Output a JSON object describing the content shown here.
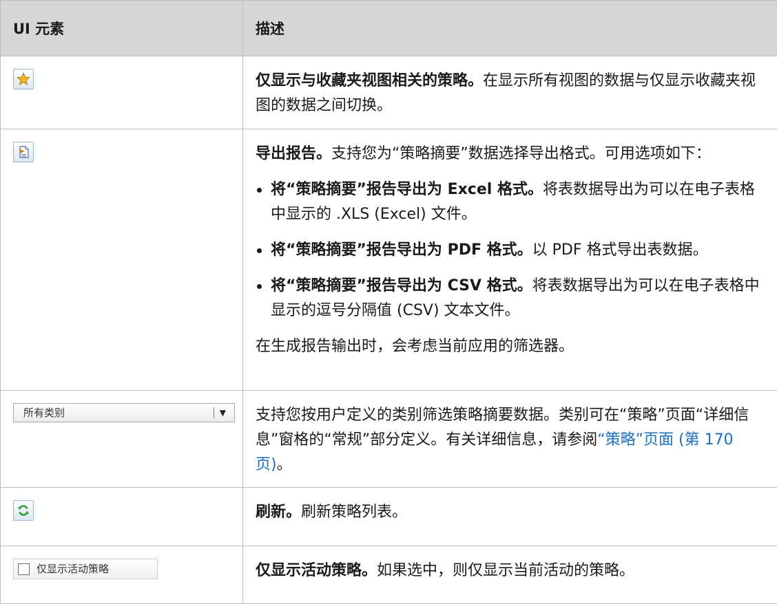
{
  "header": {
    "col1": "UI 元素",
    "col2": "描述"
  },
  "rows": {
    "favorites": {
      "icon": "star-icon",
      "title": "仅显示与收藏夹视图相关的策略。",
      "text": "在显示所有视图的数据与仅显示收藏夹视图的数据之间切换。"
    },
    "export": {
      "icon": "export-report-icon",
      "title": "导出报告。",
      "text": "支持您为“策略摘要”数据选择导出格式。可用选项如下：",
      "options": [
        {
          "bold": "将“策略摘要”报告导出为 Excel 格式。",
          "text": "将表数据导出为可以在电子表格中显示的 .XLS (Excel) 文件。"
        },
        {
          "bold": "将“策略摘要”报告导出为 PDF 格式。",
          "text": "以 PDF 格式导出表数据。"
        },
        {
          "bold": "将“策略摘要”报告导出为 CSV 格式。",
          "text": "将表数据导出为可以在电子表格中显示的逗号分隔值 (CSV) 文本文件。"
        }
      ],
      "note": "在生成报告输出时，会考虑当前应用的筛选器。"
    },
    "category": {
      "dropdown_value": "所有类别",
      "text": "支持您按用户定义的类别筛选策略摘要数据。类别可在“策略”页面“详细信息”窗格的“常规”部分定义。有关详细信息，请参阅",
      "link": "“策略”页面 (第 170 页)",
      "end": "。"
    },
    "refresh": {
      "icon": "refresh-icon",
      "title": "刷新。",
      "text": "刷新策略列表。"
    },
    "active": {
      "checkbox_label": "仅显示活动策略",
      "title": "仅显示活动策略。",
      "text": "如果选中，则仅显示当前活动的策略。"
    }
  },
  "colors": {
    "header_bg": "#d6d6d6",
    "link": "#1a6fbf",
    "refresh_green": "#2e9b3a",
    "star_gold": "#f2b51c"
  }
}
